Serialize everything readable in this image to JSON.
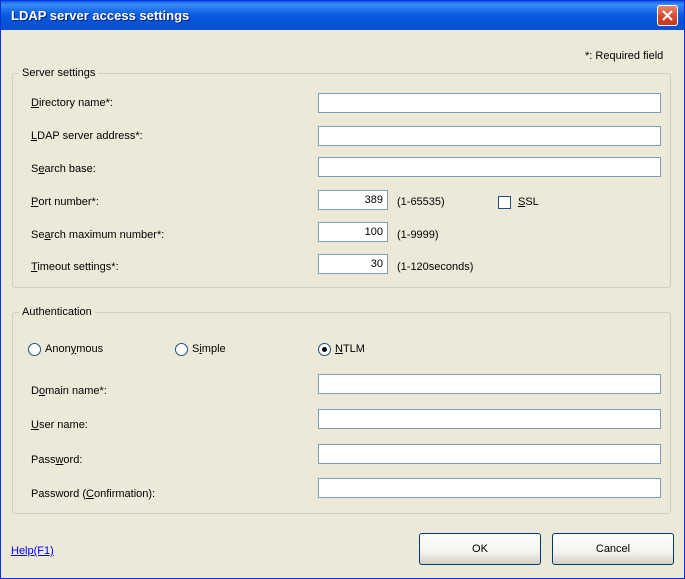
{
  "window": {
    "title": "LDAP server access settings"
  },
  "required_note": "*: Required field",
  "server_settings": {
    "legend": "Server settings",
    "directory_name": {
      "label_pre": "",
      "label_key": "D",
      "label_post": "irectory name*:",
      "value": ""
    },
    "ldap_address": {
      "label_pre": "",
      "label_key": "L",
      "label_post": "DAP server address*:",
      "value": ""
    },
    "search_base": {
      "label_pre": "S",
      "label_key": "e",
      "label_post": "arch base:",
      "value": ""
    },
    "port": {
      "label_pre": "",
      "label_key": "P",
      "label_post": "ort number*:",
      "value": "389",
      "range": "(1-65535)"
    },
    "ssl": {
      "label_pre": "",
      "label_key": "S",
      "label_post": "SL",
      "checked": false
    },
    "search_max": {
      "label_pre": "Se",
      "label_key": "a",
      "label_post": "rch maximum number*:",
      "value": "100",
      "range": "(1-9999)"
    },
    "timeout": {
      "label_pre": "",
      "label_key": "T",
      "label_post": "imeout settings*:",
      "value": "30",
      "range": "(1-120seconds)"
    }
  },
  "authentication": {
    "legend": "Authentication",
    "options": [
      {
        "label_pre": "Anon",
        "label_key": "y",
        "label_post": "mous",
        "selected": false
      },
      {
        "label_pre": "S",
        "label_key": "i",
        "label_post": "mple",
        "selected": false
      },
      {
        "label_pre": "",
        "label_key": "N",
        "label_post": "TLM",
        "selected": true
      }
    ],
    "domain_name": {
      "label_pre": "D",
      "label_key": "o",
      "label_post": "main name*:",
      "value": ""
    },
    "user_name": {
      "label_pre": "",
      "label_key": "U",
      "label_post": "ser name:",
      "value": ""
    },
    "password": {
      "label_pre": "Pass",
      "label_key": "w",
      "label_post": "ord:",
      "value": ""
    },
    "password_confirm": {
      "label_pre": "Password (",
      "label_key": "C",
      "label_post": "onfirmation):",
      "value": ""
    }
  },
  "footer": {
    "help": "Help(F1)",
    "ok": "OK",
    "cancel": "Cancel"
  },
  "colors": {
    "title_bar": "#0a5fe6",
    "dialog_bg": "#ece9d8",
    "link": "#0000ff"
  }
}
